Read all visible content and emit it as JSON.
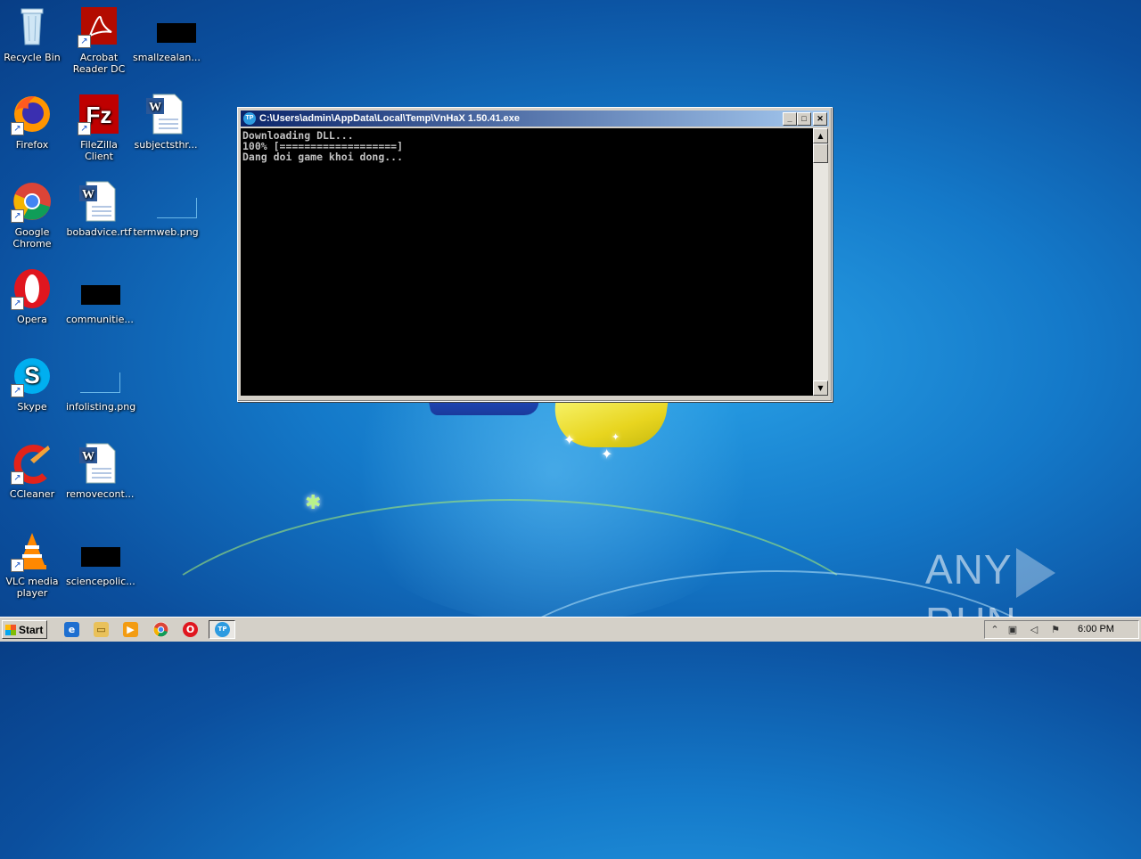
{
  "desktop": {
    "icons": [
      {
        "label": "Recycle Bin"
      },
      {
        "label": "Acrobat Reader DC"
      },
      {
        "label": "smallzealan..."
      },
      {
        "label": "Firefox"
      },
      {
        "label": "FileZilla Client"
      },
      {
        "label": "subjectsthr..."
      },
      {
        "label": "Google Chrome"
      },
      {
        "label": "bobadvice.rtf"
      },
      {
        "label": "termweb.png"
      },
      {
        "label": "Opera"
      },
      {
        "label": "communitie..."
      },
      {
        "label": "Skype"
      },
      {
        "label": "infolisting.png"
      },
      {
        "label": "CCleaner"
      },
      {
        "label": "removecont..."
      },
      {
        "label": "VLC media player"
      },
      {
        "label": "sciencepolic..."
      }
    ]
  },
  "console": {
    "title": "C:\\Users\\admin\\AppData\\Local\\Temp\\VnHaX 1.50.41.exe",
    "lines": [
      "Downloading DLL...",
      "100% [===================]",
      "Dang doi game khoi dong..."
    ],
    "buttons": {
      "minimize": "_",
      "maximize": "□",
      "close": "✕"
    }
  },
  "watermark": {
    "left": "ANY",
    "right": "RUN"
  },
  "taskbar": {
    "start_label": "Start",
    "clock": "6:00 PM"
  }
}
